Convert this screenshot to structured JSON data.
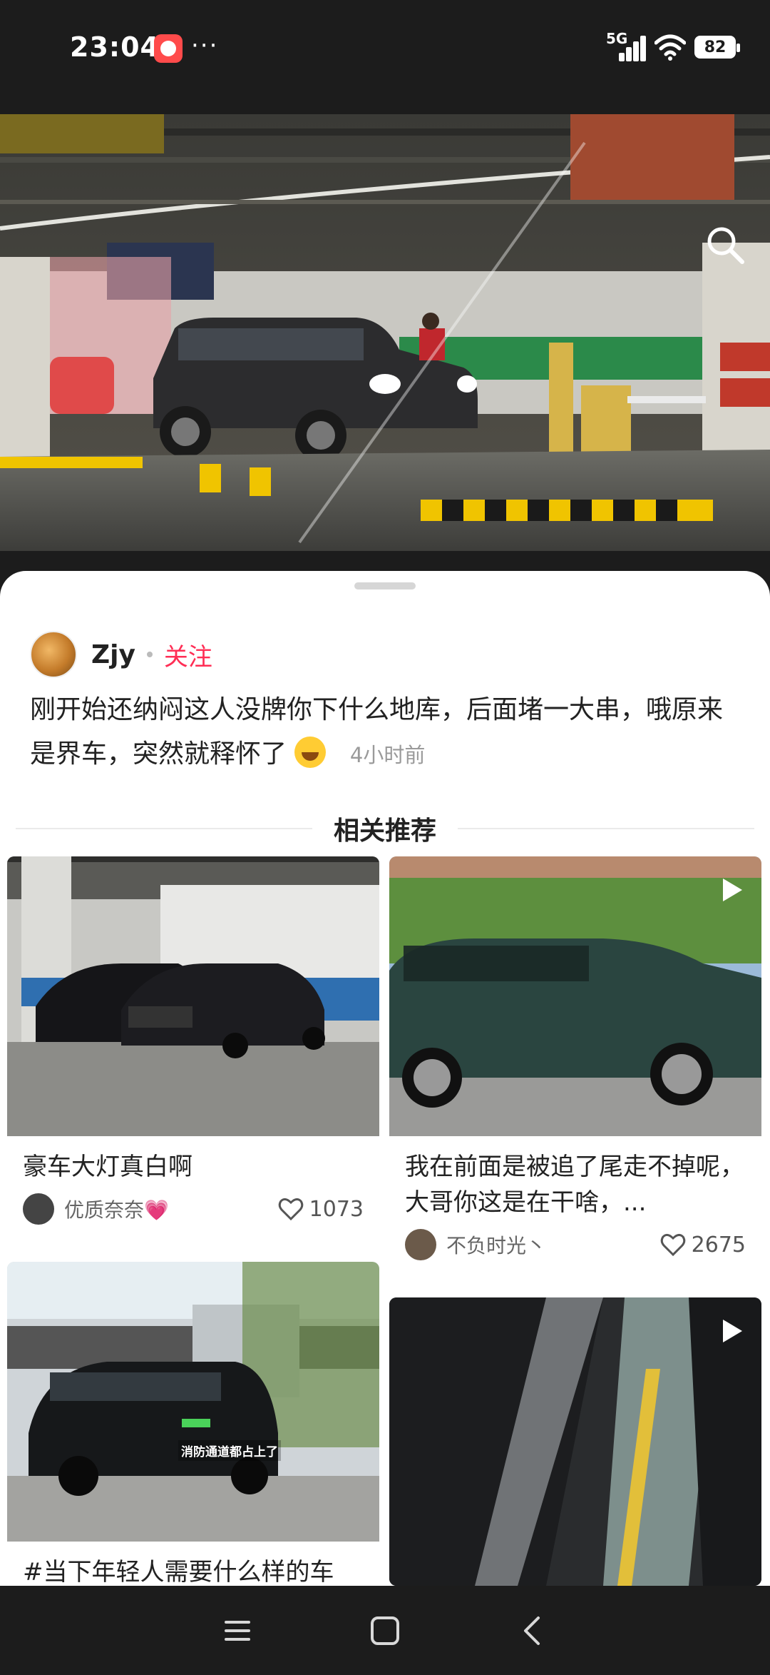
{
  "status_bar": {
    "time": "23:04",
    "more": "···",
    "network": "5G",
    "battery": "82",
    "app_icon": "notification-app-icon"
  },
  "hero": {
    "search_icon": "search-icon",
    "scene": "underground-parking-photo"
  },
  "post": {
    "author_name": "Zjy",
    "follow_label": "关注",
    "text": "刚开始还纳闷这人没牌你下什么地库，后面堵一大串，哦原来是界车，突然就释怀了",
    "emoji": "laughing-emoji",
    "time_ago": "4小时前"
  },
  "related": {
    "title": "相关推荐",
    "cards": [
      {
        "caption": "豪车大灯真白啊",
        "user": "优质奈奈💗",
        "likes": "1073",
        "is_video": false
      },
      {
        "caption": "我在前面是被追了尾走不掉呢，大哥你这是在干啥，...",
        "user": "不负时光丶",
        "likes": "2675",
        "is_video": true
      },
      {
        "caption": "#当下年轻人需要什么样的车",
        "overlay_text": "消防通道都占上了",
        "is_video": false
      },
      {
        "is_video": true
      }
    ]
  },
  "nav_bar": {
    "menu_icon": "menu-icon",
    "home_icon": "home-icon",
    "back_icon": "back-icon"
  },
  "colors": {
    "accent": "#ff2e55",
    "dark": "#1c1c1c"
  }
}
